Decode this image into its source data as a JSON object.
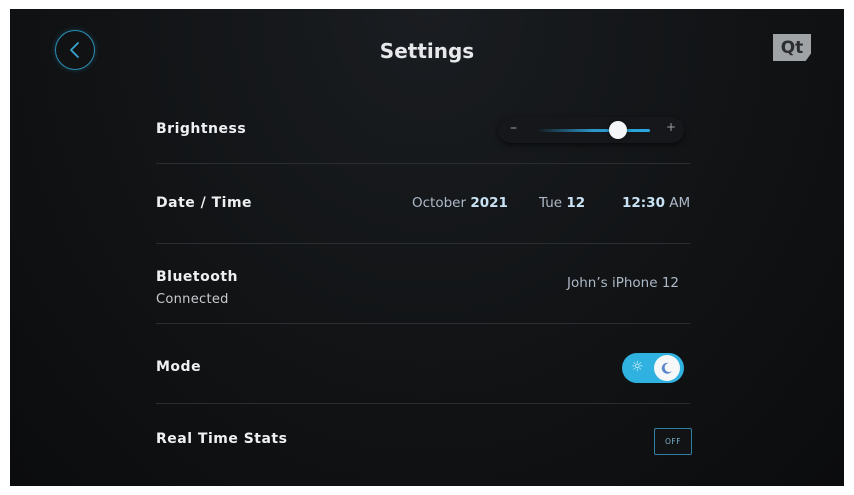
{
  "header": {
    "title": "Settings",
    "logo_text": "Qt"
  },
  "settings": {
    "brightness": {
      "label": "Brightness",
      "minus": "–",
      "plus": "+",
      "level": 0.72
    },
    "datetime": {
      "label": "Date / Time",
      "month": "October",
      "year": "2021",
      "weekday": "Tue",
      "day": "12",
      "time": "12:30",
      "ampm": "AM"
    },
    "bluetooth": {
      "label": "Bluetooth",
      "status": "Connected",
      "device": "John’s iPhone 12"
    },
    "mode": {
      "label": "Mode",
      "sun_icon": "sun-icon",
      "moon_icon": "moon-icon",
      "state": "dark"
    },
    "realtime": {
      "label": "Real Time Stats",
      "button": "OFF"
    }
  },
  "colors": {
    "accent": "#2fb2df",
    "background": "#111315",
    "divider": "#2a2d31"
  }
}
